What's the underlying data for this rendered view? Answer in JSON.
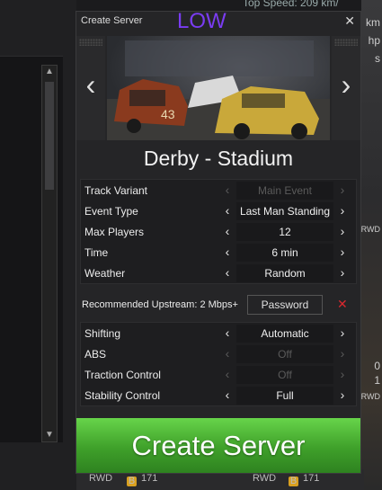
{
  "background": {
    "top_text": "Top Speed: 209 km/",
    "right_texts": [
      "km",
      "hp",
      "s",
      "RWD",
      "RWD",
      "0",
      "1"
    ],
    "bottom": {
      "left_drive": "RWD",
      "left_badge": "B",
      "left_num": "171",
      "right_drive": "RWD",
      "right_badge": "B",
      "right_num": "171"
    }
  },
  "dialog": {
    "title": "Create Server",
    "watermark": "LOW",
    "close_icon": "close-icon",
    "preview": {
      "prev_icon": "chevron-left-icon",
      "next_icon": "chevron-right-icon"
    },
    "track_name": "Derby - Stadium"
  },
  "settings": [
    {
      "label": "Track Variant",
      "value": "Main Event",
      "enabled": false
    },
    {
      "label": "Event Type",
      "value": "Last Man Standing",
      "enabled": true
    },
    {
      "label": "Max Players",
      "value": "12",
      "enabled": true
    },
    {
      "label": "Time",
      "value": "6 min",
      "enabled": true
    },
    {
      "label": "Weather",
      "value": "Random",
      "enabled": true
    }
  ],
  "upstream": {
    "label": "Recommended Upstream: 2 Mbps+",
    "password_button": "Password",
    "clear_icon": "x-icon"
  },
  "assists": [
    {
      "label": "Shifting",
      "value": "Automatic",
      "enabled": true
    },
    {
      "label": "ABS",
      "value": "Off",
      "enabled": false
    },
    {
      "label": "Traction Control",
      "value": "Off",
      "enabled": false
    },
    {
      "label": "Stability Control",
      "value": "Full",
      "enabled": true
    }
  ],
  "create_button": "Create Server",
  "colors": {
    "accent_green": "#4cb834",
    "watermark": "#7a3cf2",
    "clear_red": "#d8282e"
  },
  "scroll": {
    "up_icon": "arrow-up-icon",
    "down_icon": "arrow-down-icon"
  }
}
